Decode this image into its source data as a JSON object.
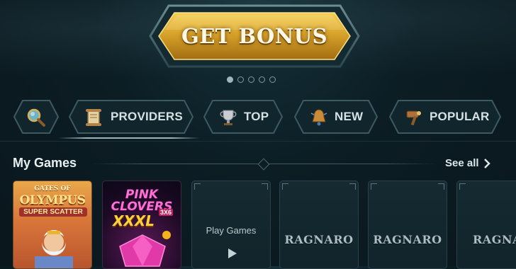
{
  "promo": {
    "bonus_button_label": "GET BONUS",
    "carousel_pages": 5,
    "active_page": 1
  },
  "categories": [
    {
      "label": "",
      "icon": "search-icon"
    },
    {
      "label": "PROVIDERS",
      "icon": "scroll-icon"
    },
    {
      "label": "TOP",
      "icon": "trophy-icon"
    },
    {
      "label": "NEW",
      "icon": "bell-icon"
    },
    {
      "label": "POPULAR",
      "icon": "hammer-icon"
    }
  ],
  "my_games": {
    "title": "My Games",
    "see_all_label": "See all",
    "cards": [
      {
        "type": "game",
        "title_line1": "GATES OF",
        "title_line2": "OLYMPUS",
        "subtitle": "SUPER SCATTER"
      },
      {
        "type": "game",
        "title_line1": "PINK",
        "title_line2": "CLOVERS",
        "title_line3": "XXXL",
        "badge": "3X6"
      },
      {
        "type": "placeholder",
        "label": "Play Games"
      },
      {
        "type": "provider",
        "label": "RAGNARO"
      },
      {
        "type": "provider",
        "label": "RAGNARO"
      },
      {
        "type": "provider",
        "label": "RAGNARO"
      }
    ]
  },
  "colors": {
    "background": "#0c1d24",
    "bonus_gold": "#d8a32a",
    "frame_teal": "#4a6a72",
    "text_light": "#d5e1e3"
  }
}
